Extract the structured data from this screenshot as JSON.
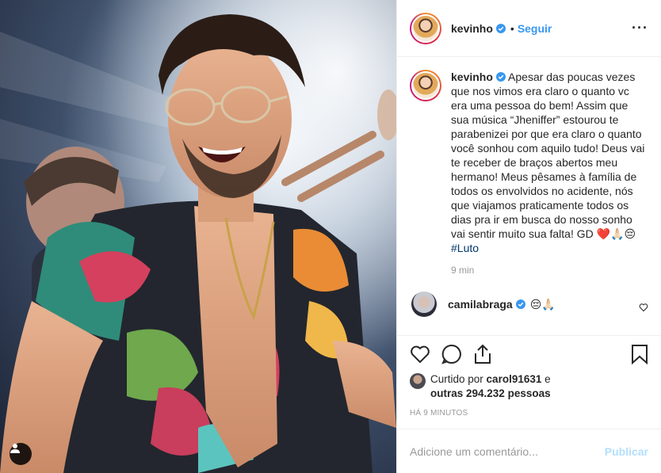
{
  "header": {
    "username": "kevinho",
    "separator": "•",
    "follow_label": "Seguir",
    "more_label": "···"
  },
  "caption": {
    "username": "kevinho",
    "text": "Apesar das poucas vezes que nos vimos era claro o quanto vc era uma pessoa do bem! Assim que sua música “Jheniffer” estourou te parabenizei por que era claro o quanto você sonhou com aquilo tudo! Deus vai te receber de braços abertos meu hermano! Meus pêsames à família de todos os envolvidos no acidente, nós que viajamos praticamente todos os dias pra ir em busca do nosso sonho vai sentir muito sua falta! GD ❤️🙏🏻😔",
    "hashtag": "#Luto",
    "time": "9 min"
  },
  "comment": {
    "username": "camilabraga",
    "text": "😔🙏🏻"
  },
  "likes": {
    "prefix": "Curtido por ",
    "first_liker": "carol91631",
    "conjunction": " e",
    "others_prefix": "outras ",
    "others_count": "294.232",
    "others_suffix": " pessoas"
  },
  "post_age": "HÁ 9 MINUTOS",
  "add_comment": {
    "placeholder": "Adicione um comentário...",
    "publish_label": "Publicar"
  },
  "colors": {
    "link": "#3897f0",
    "hashtag": "#003569",
    "publish_disabled": "#b2dffc",
    "verified": "#3897f0"
  },
  "icons": [
    "verified-badge-icon",
    "more-options-icon",
    "heart-icon",
    "comment-icon",
    "share-icon",
    "bookmark-icon",
    "user-tag-icon"
  ]
}
